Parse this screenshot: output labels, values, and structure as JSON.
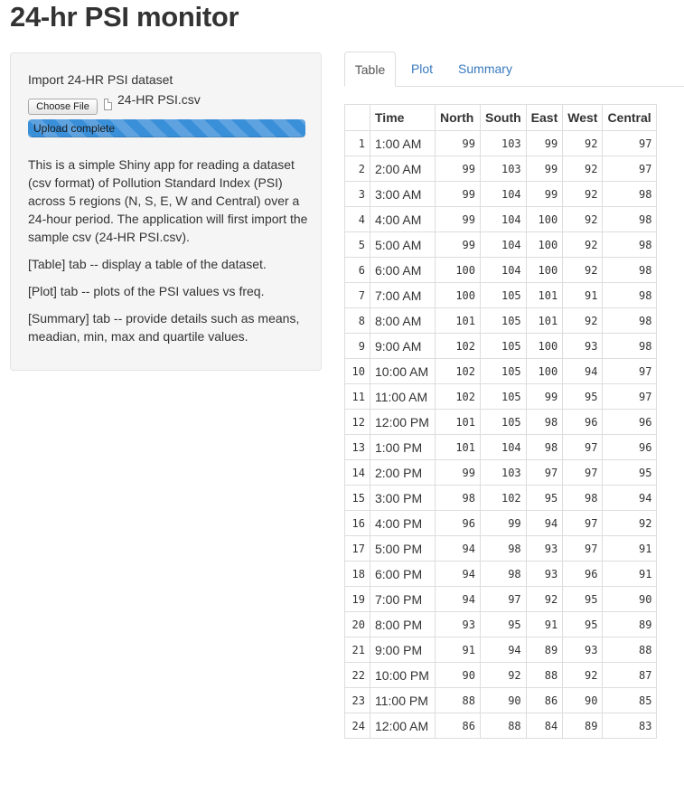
{
  "page": {
    "title": "24-hr PSI monitor"
  },
  "sidebar": {
    "file_label": "Import 24-HR PSI dataset",
    "choose_button": "Choose File",
    "file_name": "24-HR PSI.csv",
    "upload_status": "Upload complete",
    "upload_progress": 1.0,
    "paragraphs": [
      "This is a simple Shiny app for reading a dataset (csv format) of Pollution Standard Index (PSI) across 5 regions (N, S, E, W and Central) over a 24-hour period. The application will first import the sample csv (24-HR PSI.csv).",
      "[Table] tab -- display a table of the dataset.",
      "[Plot] tab -- plots of the PSI values vs freq.",
      "[Summary] tab -- provide details such as means, meadian, min, max and quartile values."
    ]
  },
  "tabs": [
    {
      "label": "Table",
      "active": true
    },
    {
      "label": "Plot",
      "active": false
    },
    {
      "label": "Summary",
      "active": false
    }
  ],
  "table": {
    "columns": [
      "",
      "Time",
      "North",
      "South",
      "East",
      "West",
      "Central"
    ],
    "rows": [
      [
        "1",
        "1:00 AM",
        "99",
        "103",
        "99",
        "92",
        "97"
      ],
      [
        "2",
        "2:00 AM",
        "99",
        "103",
        "99",
        "92",
        "97"
      ],
      [
        "3",
        "3:00 AM",
        "99",
        "104",
        "99",
        "92",
        "98"
      ],
      [
        "4",
        "4:00 AM",
        "99",
        "104",
        "100",
        "92",
        "98"
      ],
      [
        "5",
        "5:00 AM",
        "99",
        "104",
        "100",
        "92",
        "98"
      ],
      [
        "6",
        "6:00 AM",
        "100",
        "104",
        "100",
        "92",
        "98"
      ],
      [
        "7",
        "7:00 AM",
        "100",
        "105",
        "101",
        "91",
        "98"
      ],
      [
        "8",
        "8:00 AM",
        "101",
        "105",
        "101",
        "92",
        "98"
      ],
      [
        "9",
        "9:00 AM",
        "102",
        "105",
        "100",
        "93",
        "98"
      ],
      [
        "10",
        "10:00 AM",
        "102",
        "105",
        "100",
        "94",
        "97"
      ],
      [
        "11",
        "11:00 AM",
        "102",
        "105",
        "99",
        "95",
        "97"
      ],
      [
        "12",
        "12:00 PM",
        "101",
        "105",
        "98",
        "96",
        "96"
      ],
      [
        "13",
        "1:00 PM",
        "101",
        "104",
        "98",
        "97",
        "96"
      ],
      [
        "14",
        "2:00 PM",
        "99",
        "103",
        "97",
        "97",
        "95"
      ],
      [
        "15",
        "3:00 PM",
        "98",
        "102",
        "95",
        "98",
        "94"
      ],
      [
        "16",
        "4:00 PM",
        "96",
        "99",
        "94",
        "97",
        "92"
      ],
      [
        "17",
        "5:00 PM",
        "94",
        "98",
        "93",
        "97",
        "91"
      ],
      [
        "18",
        "6:00 PM",
        "94",
        "98",
        "93",
        "96",
        "91"
      ],
      [
        "19",
        "7:00 PM",
        "94",
        "97",
        "92",
        "95",
        "90"
      ],
      [
        "20",
        "8:00 PM",
        "93",
        "95",
        "91",
        "95",
        "89"
      ],
      [
        "21",
        "9:00 PM",
        "91",
        "94",
        "89",
        "93",
        "88"
      ],
      [
        "22",
        "10:00 PM",
        "90",
        "92",
        "88",
        "92",
        "87"
      ],
      [
        "23",
        "11:00 PM",
        "88",
        "90",
        "86",
        "90",
        "85"
      ],
      [
        "24",
        "12:00 AM",
        "86",
        "88",
        "84",
        "89",
        "83"
      ]
    ]
  },
  "colors": {
    "link": "#3a7bbf",
    "progress": "#3a8fd9",
    "panel_bg": "#f5f5f5"
  }
}
